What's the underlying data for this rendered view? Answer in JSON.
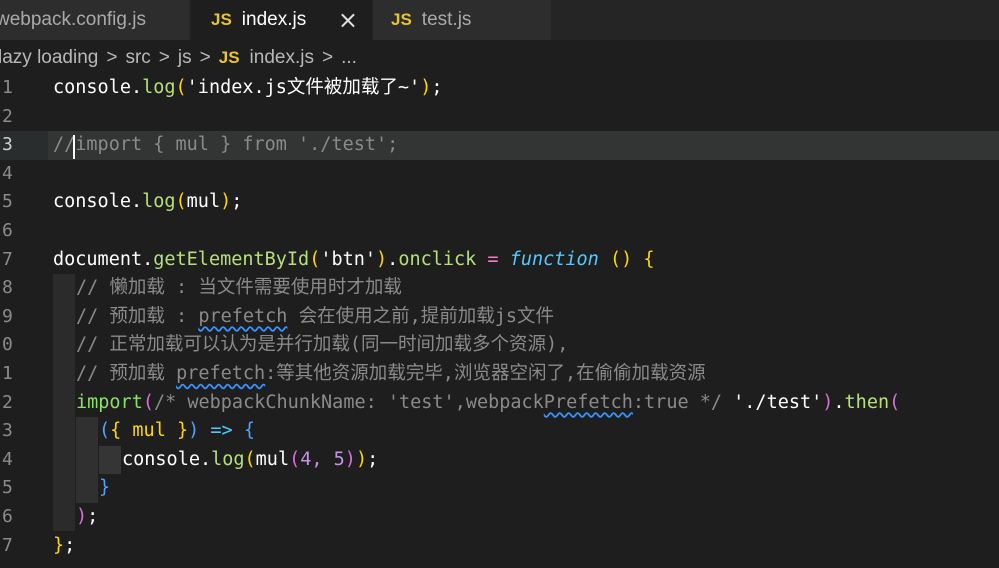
{
  "tabs": [
    {
      "label": "webpack.config.js",
      "badge": ""
    },
    {
      "label": "index.js",
      "badge": "JS",
      "close": "×"
    },
    {
      "label": "test.js",
      "badge": "JS"
    }
  ],
  "breadcrumb": {
    "items": [
      "lazy loading",
      "src",
      "js"
    ],
    "file_badge": "JS",
    "file": "index.js",
    "tail": "...",
    "separator": ">"
  },
  "line_numbers": [
    "1",
    "2",
    "3",
    "4",
    "5",
    "6",
    "7",
    "8",
    "9",
    "0",
    "1",
    "2",
    "3",
    "4",
    "5",
    "6",
    "7"
  ],
  "code": {
    "l1": [
      "console",
      ".",
      "log",
      "(",
      "'index.js文件被加载了~'",
      ")",
      ";"
    ],
    "l3": "//import { mul } from './test';",
    "l5": [
      "console",
      ".",
      "log",
      "(",
      "mul",
      ")",
      ";"
    ],
    "l7": [
      "document",
      ".",
      "getElementById",
      "(",
      "'btn'",
      ")",
      ".",
      "onclick",
      " = ",
      "function",
      " () {"
    ],
    "l8": "// 懒加载 : 当文件需要使用时才加载",
    "l9": [
      "// 预加载 : ",
      "prefetch",
      " 会在使用之前,提前加载js文件"
    ],
    "l10": "// 正常加载可以认为是并行加载(同一时间加载多个资源),",
    "l11": [
      "// 预加载 ",
      "prefetch",
      ":等其他资源加载完毕,浏览器空闲了,在偷偷加载资源"
    ],
    "l12": [
      "import",
      "(",
      "/* webpackChunkName: 'test',webpack",
      "Prefetch",
      ":true */",
      " ",
      "'./test'",
      ")",
      ".",
      "then",
      "("
    ],
    "l13": [
      "(",
      "{ mul }",
      ")",
      " => ",
      "{"
    ],
    "l14": [
      "console",
      ".",
      "log",
      "(",
      "mul",
      "(",
      "4, 5",
      ")",
      ")",
      ";"
    ],
    "l15": "}",
    "l16": [
      ")",
      ";"
    ],
    "l17": [
      "}",
      ";"
    ]
  },
  "colors": {
    "background": "#1e1e1e",
    "tab_inactive": "#2d2d2d",
    "js_badge": "#e8c336",
    "comment": "#8a8a8a",
    "function_name": "#b5e07a"
  }
}
